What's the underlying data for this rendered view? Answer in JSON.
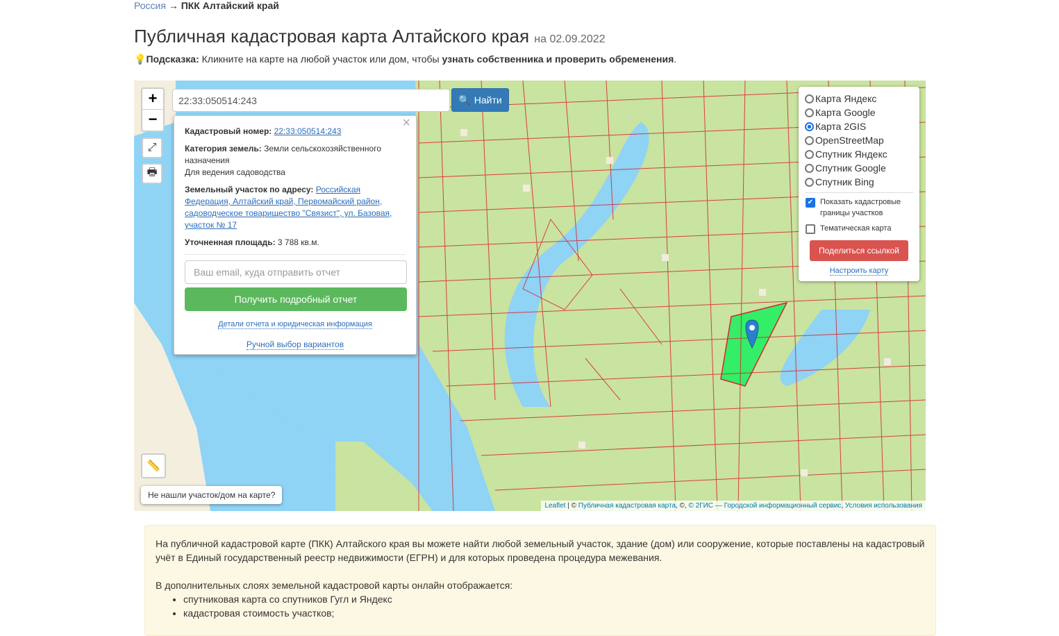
{
  "breadcrumb": {
    "root": "Россия",
    "arrow": "→",
    "current": "ПКК Алтайский край"
  },
  "header": {
    "title": "Публичная кадастровая карта Алтайского края",
    "date": "на 02.09.2022"
  },
  "hint": {
    "label": "Подсказка:",
    "text": " Кликните на карте на любой участок или дом, чтобы ",
    "bold": "узнать собственника и проверить обременения",
    "end": "."
  },
  "map": {
    "zoom_in": "+",
    "zoom_out": "−",
    "search_value": "22:33:050514:243",
    "search_button": "Найти",
    "popup": {
      "cad_label": "Кадастровый номер:",
      "cad_value": "22:33:050514:243",
      "cat_label": "Категория земель:",
      "cat_value": " Земли сельскохозяйственного назначения",
      "use": "Для ведения садоводства",
      "addr_label": "Земельный участок по адресу:",
      "addr_value": "Российская Федерация, Алтайский край, Первомайский район, садоводческое товарищество \"Связист\", ул. Базовая, участок № 17",
      "area_label": "Уточненная площадь:",
      "area_value": " 3 788 кв.м.",
      "email_placeholder": "Ваш email, куда отправить отчет",
      "get_report": "Получить подробный отчет",
      "details_link": "Детали отчета и юридическая информация",
      "manual_link": "Ручной выбор вариантов",
      "close": "×"
    },
    "layers": {
      "options": [
        "Карта Яндекс",
        "Карта Google",
        "Карта 2GIS",
        "OpenStreetMap",
        "Спутник Яндекс",
        "Спутник Google",
        "Спутник Bing"
      ],
      "selected": "Карта 2GIS",
      "show_borders": "Показать кадастровые границы участков",
      "show_borders_checked": true,
      "thematic": "Тематическая карта",
      "thematic_checked": false,
      "share": "Поделиться ссылкой",
      "configure": "Настроить карту"
    },
    "not_found": "Не нашли участок/дом на карте?",
    "attribution": {
      "leaflet": "Leaflet",
      "sep": " | © ",
      "pkk": "Публичная кадастровая карта",
      "mid": ", ©, ",
      "gis": "© 2ГИС — Городской информационный сервис",
      "comma": ", ",
      "terms": "Условия использования"
    }
  },
  "info": {
    "p1": "На публичной кадастровой карте (ПКК) Алтайского края вы можете найти любой земельный участок, здание (дом) или сооружение, которые поставлены на кадастровый учёт в Единый государственный реестр недвижимости (ЕГРН) и для которых проведена процедура межевания.",
    "p2": "В дополнительных слоях земельной кадастровой карты онлайн отображается:",
    "items": [
      "спутниковая карта со спутников Гугл и Яндекс",
      "кадастровая стоимость участков;"
    ]
  },
  "colors": {
    "water": "#8fd3f5",
    "land": "#c9e3a0",
    "parcel": "#d9232e",
    "selected": "#33ee66",
    "link": "#2a6ebb"
  }
}
